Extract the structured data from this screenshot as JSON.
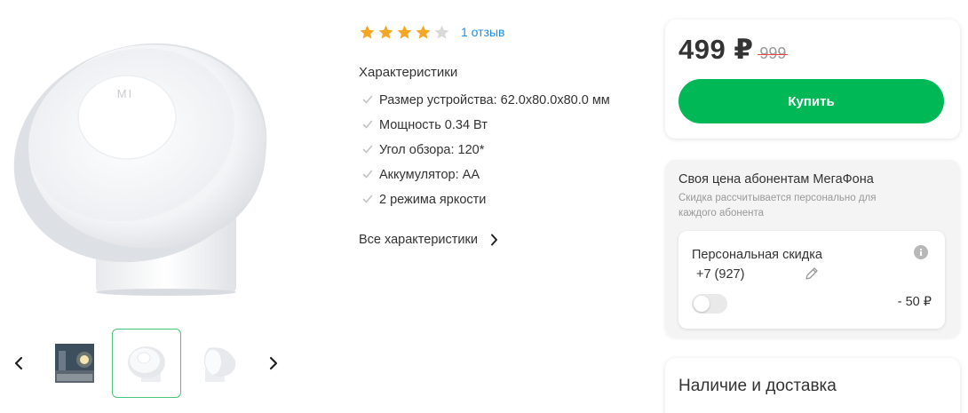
{
  "rating": {
    "stars_filled": 4,
    "stars_total": 5,
    "review_link": "1 отзыв"
  },
  "characteristics": {
    "title": "Характеристики",
    "items": [
      "Размер устройства: 62.0x80.0x80.0 мм",
      "Мощность 0.34 Вт",
      "Угол обзора: 120*",
      "Аккумулятор: АА",
      "2 режима яркости"
    ],
    "all_link": "Все характеристики"
  },
  "product_logo": "MI",
  "price": {
    "current": "499 ₽",
    "old": "999",
    "buy_label": "Купить"
  },
  "megafon": {
    "title": "Своя цена абонентам МегаФона",
    "subtitle": "Скидка рассчитывается персонально для каждого абонента",
    "discount_title": "Персональная скидка",
    "phone": "+7 (927)",
    "discount_amount": "- 50 ₽",
    "toggle_on": false
  },
  "availability": {
    "title": "Наличие и доставка"
  },
  "colors": {
    "accent_green": "#00b956",
    "star": "#f5a623",
    "star_empty": "#d9d9d9",
    "link": "#1f8de0",
    "strike": "#e44444"
  },
  "gallery": {
    "selected_index": 1,
    "thumbnails": [
      "photo-room-thumbnail",
      "lamp-front-thumbnail",
      "lamp-side-thumbnail"
    ]
  }
}
